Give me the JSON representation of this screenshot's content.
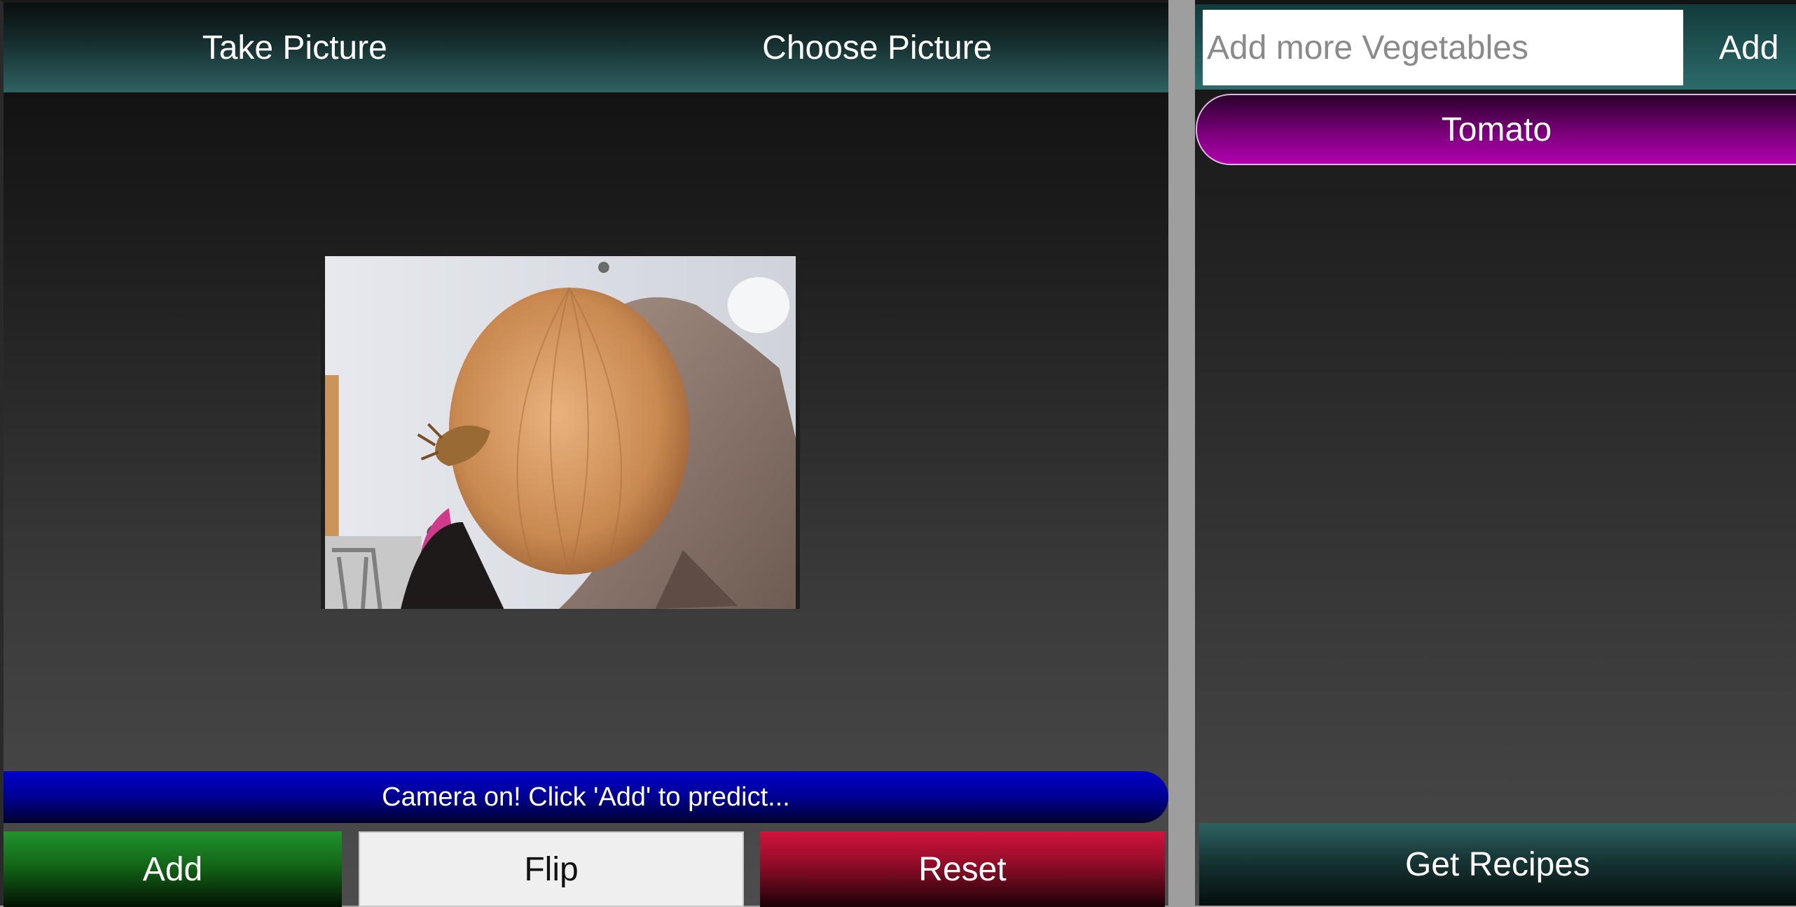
{
  "left": {
    "top_bar": {
      "take_picture": "Take Picture",
      "choose_picture": "Choose Picture"
    },
    "status": "Camera on! Click 'Add' to predict...",
    "buttons": {
      "add": "Add",
      "flip": "Flip",
      "reset": "Reset"
    }
  },
  "right": {
    "input_placeholder": "Add more Vegetables",
    "input_value": "",
    "add_label": "Add",
    "vegetables": [
      "Tomato"
    ],
    "get_recipes": "Get Recipes"
  },
  "colors": {
    "teal_accent": "#2e6262",
    "add_green": "#23922e",
    "reset_red": "#d2133c",
    "status_blue": "#0000c8",
    "vegetable_magenta": "#b000b0"
  }
}
